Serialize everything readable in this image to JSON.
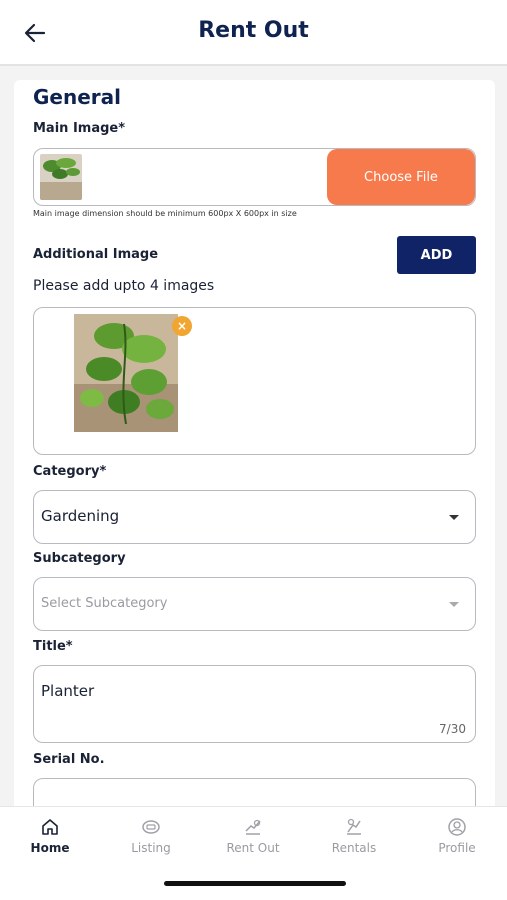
{
  "header": {
    "title": "Rent Out"
  },
  "form": {
    "section_title": "General",
    "main_image": {
      "label": "Main Image*",
      "button_label": "Choose File",
      "hint": "Main image dimension should be minimum 600px X 600px in size"
    },
    "additional_image": {
      "label": "Additional Image",
      "add_label": "ADD",
      "helper": "Please add upto 4 images",
      "remove_glyph": "×"
    },
    "category": {
      "label": "Category*",
      "value": "Gardening"
    },
    "subcategory": {
      "label": "Subcategory",
      "placeholder": "Select Subcategory"
    },
    "title": {
      "label": "Title*",
      "value": "Planter",
      "counter": "7/30"
    },
    "serial": {
      "label": "Serial No.",
      "value": ""
    }
  },
  "bottom_nav": {
    "items": [
      {
        "label": "Home",
        "icon": "home-icon",
        "active": true
      },
      {
        "label": "Listing",
        "icon": "listing-icon",
        "active": false
      },
      {
        "label": "Rent Out",
        "icon": "rent-out-icon",
        "active": false
      },
      {
        "label": "Rentals",
        "icon": "rentals-icon",
        "active": false
      },
      {
        "label": "Profile",
        "icon": "profile-icon",
        "active": false
      }
    ]
  },
  "colors": {
    "primary": "#0f2350",
    "accent": "#f77a4d",
    "add_button": "#0f2366",
    "badge": "#f0a630"
  }
}
